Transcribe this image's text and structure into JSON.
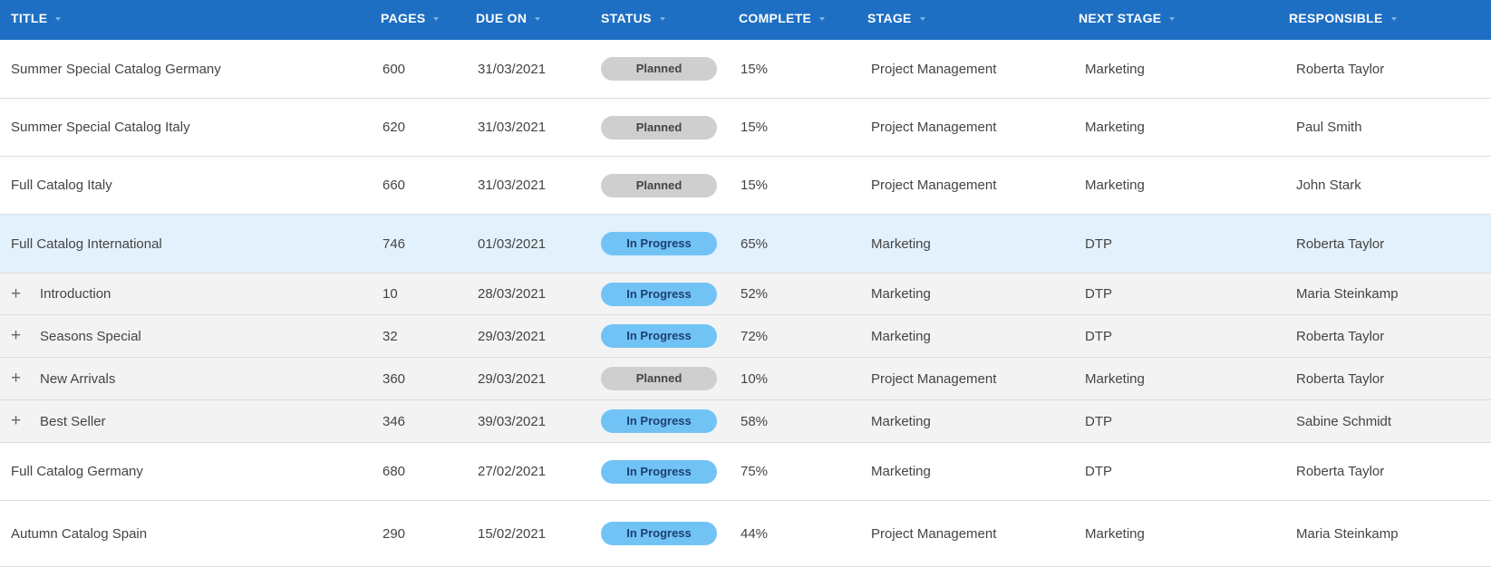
{
  "columns": [
    {
      "label": "TITLE"
    },
    {
      "label": "PAGES"
    },
    {
      "label": "DUE ON"
    },
    {
      "label": "STATUS"
    },
    {
      "label": "COMPLETE"
    },
    {
      "label": "STAGE"
    },
    {
      "label": "NEXT STAGE"
    },
    {
      "label": "RESPONSIBLE"
    }
  ],
  "colors": {
    "header_bg": "#1e6fc3",
    "planned_badge": "#cfcfcf",
    "in_progress_badge": "#72c3f5",
    "selected_row": "#e3f1fd",
    "child_row": "#f3f3f3"
  },
  "rows": [
    {
      "title": "Summer Special Catalog Germany",
      "pages": "600",
      "due": "31/03/2021",
      "status": "Planned",
      "complete": "15%",
      "stage": "Project Management",
      "next_stage": "Marketing",
      "responsible": "Roberta Taylor",
      "kind": "parent"
    },
    {
      "title": "Summer Special Catalog Italy",
      "pages": "620",
      "due": "31/03/2021",
      "status": "Planned",
      "complete": "15%",
      "stage": "Project Management",
      "next_stage": "Marketing",
      "responsible": "Paul Smith",
      "kind": "parent"
    },
    {
      "title": "Full Catalog Italy",
      "pages": "660",
      "due": "31/03/2021",
      "status": "Planned",
      "complete": "15%",
      "stage": "Project Management",
      "next_stage": "Marketing",
      "responsible": "John Stark",
      "kind": "parent"
    },
    {
      "title": "Full Catalog International",
      "pages": "746",
      "due": "01/03/2021",
      "status": "In Progress",
      "complete": "65%",
      "stage": "Marketing",
      "next_stage": "DTP",
      "responsible": "Roberta Taylor",
      "kind": "selected"
    },
    {
      "title": "Introduction",
      "pages": "10",
      "due": "28/03/2021",
      "status": "In Progress",
      "complete": "52%",
      "stage": "Marketing",
      "next_stage": "DTP",
      "responsible": "Maria Steinkamp",
      "kind": "child",
      "expand": "+"
    },
    {
      "title": "Seasons Special",
      "pages": "32",
      "due": "29/03/2021",
      "status": "In Progress",
      "complete": "72%",
      "stage": "Marketing",
      "next_stage": "DTP",
      "responsible": "Roberta Taylor",
      "kind": "child",
      "expand": "+"
    },
    {
      "title": "New Arrivals",
      "pages": "360",
      "due": "29/03/2021",
      "status": "Planned",
      "complete": "10%",
      "stage": "Project Management",
      "next_stage": "Marketing",
      "responsible": "Roberta Taylor",
      "kind": "child",
      "expand": "+"
    },
    {
      "title": "Best Seller",
      "pages": "346",
      "due": "39/03/2021",
      "status": "In Progress",
      "complete": "58%",
      "stage": "Marketing",
      "next_stage": "DTP",
      "responsible": "Sabine Schmidt",
      "kind": "child",
      "expand": "+"
    },
    {
      "title": "Full Catalog Germany",
      "pages": "680",
      "due": "27/02/2021",
      "status": "In Progress",
      "complete": "75%",
      "stage": "Marketing",
      "next_stage": "DTP",
      "responsible": "Roberta Taylor",
      "kind": "parent"
    },
    {
      "title": "Autumn Catalog Spain",
      "pages": "290",
      "due": "15/02/2021",
      "status": "In Progress",
      "complete": "44%",
      "stage": "Project Management",
      "next_stage": "Marketing",
      "responsible": "Maria Steinkamp",
      "kind": "parent"
    }
  ]
}
